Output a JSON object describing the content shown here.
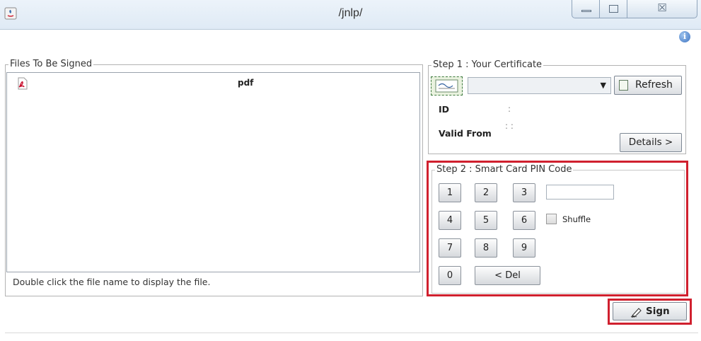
{
  "window": {
    "title": "/jnlp/",
    "app_icon": "java-icon",
    "controls": [
      "minimize-icon",
      "maximize-icon",
      "close-icon"
    ],
    "close_glyph": "☒"
  },
  "info_icon": "info-icon",
  "files": {
    "legend": "Files To Be Signed",
    "items": [
      {
        "icon": "pdf-icon",
        "name": "pdf"
      }
    ],
    "hint": "Double click the file name to display the file."
  },
  "step1": {
    "legend": "Step 1 : Your Certificate",
    "certificate_icon": "certificate-icon",
    "certificate_value": "",
    "refresh_label": "Refresh",
    "id_label": "ID",
    "id_sep": ":",
    "valid_from_label": "Valid From",
    "valid_from_sep": ":  :",
    "details_label": "Details >"
  },
  "step2": {
    "legend": "Step 2 : Smart Card PIN Code",
    "keys": [
      "1",
      "2",
      "3",
      "4",
      "5",
      "6",
      "7",
      "8",
      "9",
      "0"
    ],
    "del_label": "< Del",
    "pin_value": "",
    "shuffle_label": "Shuffle",
    "shuffle_checked": false
  },
  "sign_label": "Sign",
  "colors": {
    "highlight": "#d0202e",
    "titlebar": "#dfeaf5"
  }
}
